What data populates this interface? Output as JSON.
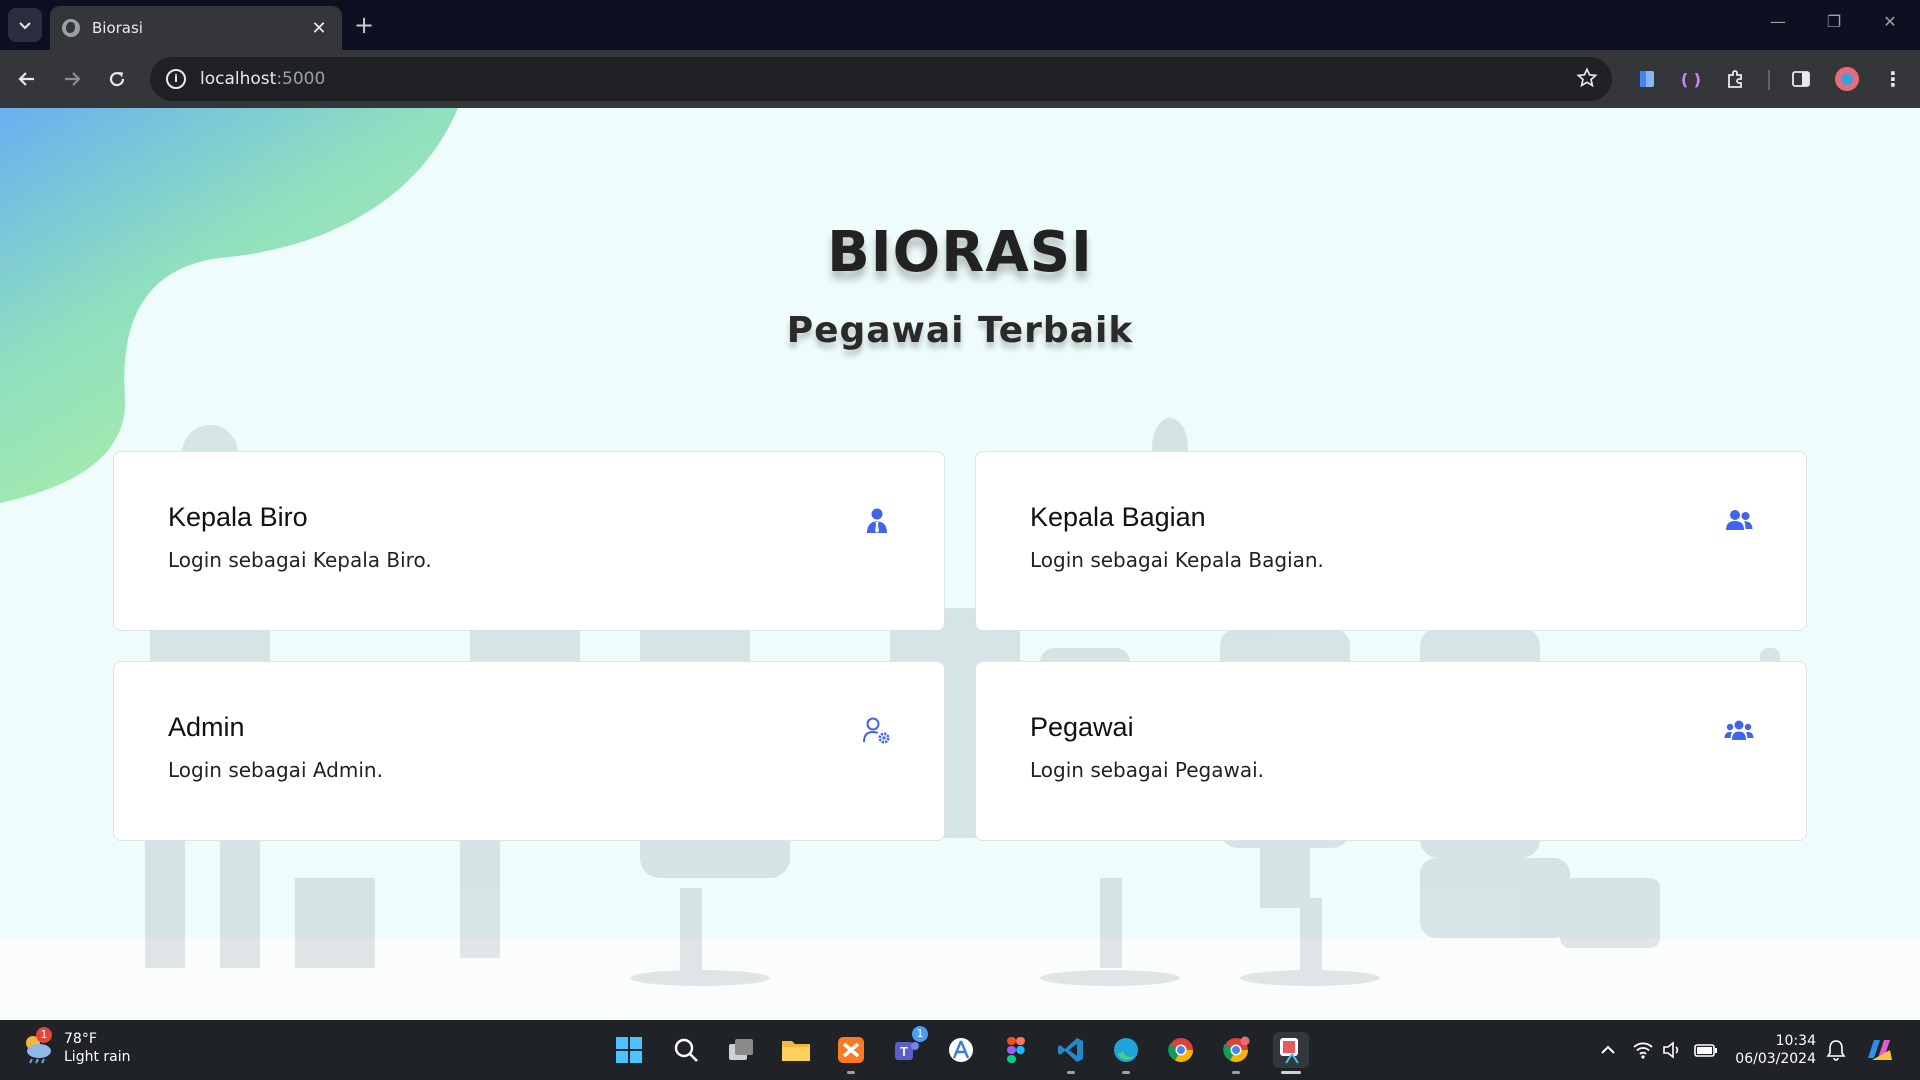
{
  "browser": {
    "tab_title": "Biorasi",
    "url_host": "localhost",
    "url_port": ":5000"
  },
  "page": {
    "title": "BIORASI",
    "subtitle": "Pegawai Terbaik",
    "cards": [
      {
        "title": "Kepala Biro",
        "desc": "Login sebagai Kepala Biro.",
        "icon": "user-tie-icon"
      },
      {
        "title": "Kepala Bagian",
        "desc": "Login sebagai Kepala Bagian.",
        "icon": "user-friends-icon"
      },
      {
        "title": "Admin",
        "desc": "Login sebagai Admin.",
        "icon": "user-cog-icon"
      },
      {
        "title": "Pegawai",
        "desc": "Login sebagai Pegawai.",
        "icon": "users-icon"
      }
    ],
    "accent_color": "#4263eb"
  },
  "taskbar": {
    "weather_temp": "78°F",
    "weather_desc": "Light rain",
    "weather_badge": "1",
    "teams_badge": "1",
    "time": "10:34",
    "date": "06/03/2024"
  }
}
